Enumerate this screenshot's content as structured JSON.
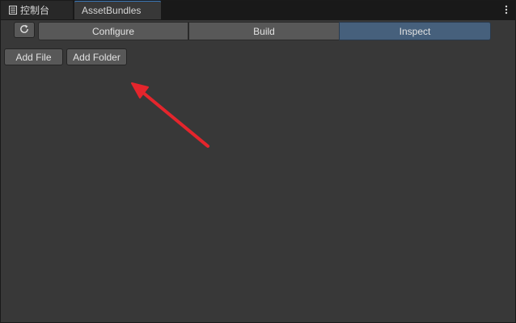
{
  "tabs": {
    "console_label": "控制台",
    "assetbundles_label": "AssetBundles"
  },
  "toolbar": {
    "refresh_icon": "refresh-icon",
    "segments": [
      "Configure",
      "Build",
      "Inspect"
    ],
    "selected": "Inspect"
  },
  "actions": {
    "add_file_label": "Add File",
    "add_folder_label": "Add Folder"
  },
  "colors": {
    "background": "#383838",
    "tabbar": "#191919",
    "selected_segment": "#46607c",
    "annotation_arrow": "#e4252c"
  }
}
